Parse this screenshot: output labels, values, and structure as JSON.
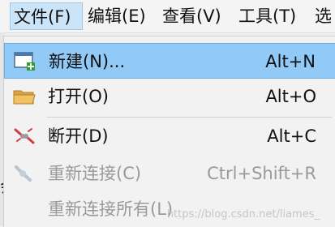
{
  "menubar": {
    "items": [
      {
        "label": "文件(F)"
      },
      {
        "label": "编辑(E)"
      },
      {
        "label": "查看(V)"
      },
      {
        "label": "工具(T)"
      },
      {
        "label": "选"
      }
    ]
  },
  "file_menu": {
    "items": [
      {
        "label": "新建(N)...",
        "shortcut": "Alt+N",
        "icon": "new-window-icon",
        "state": "highlighted"
      },
      {
        "label": "打开(O)",
        "shortcut": "Alt+O",
        "icon": "folder-icon",
        "state": "enabled"
      },
      {
        "label": "断开(D)",
        "shortcut": "Alt+C",
        "icon": "disconnect-icon",
        "state": "enabled"
      },
      {
        "label": "重新连接(C)",
        "shortcut": "Ctrl+Shift+R",
        "icon": "reconnect-icon",
        "state": "disabled"
      },
      {
        "label": "重新连接所有(L)",
        "shortcut": "",
        "icon": "",
        "state": "disabled"
      }
    ]
  },
  "background": {
    "partial_char": "会"
  },
  "watermark": "https://blog.csdn.net/liames_"
}
